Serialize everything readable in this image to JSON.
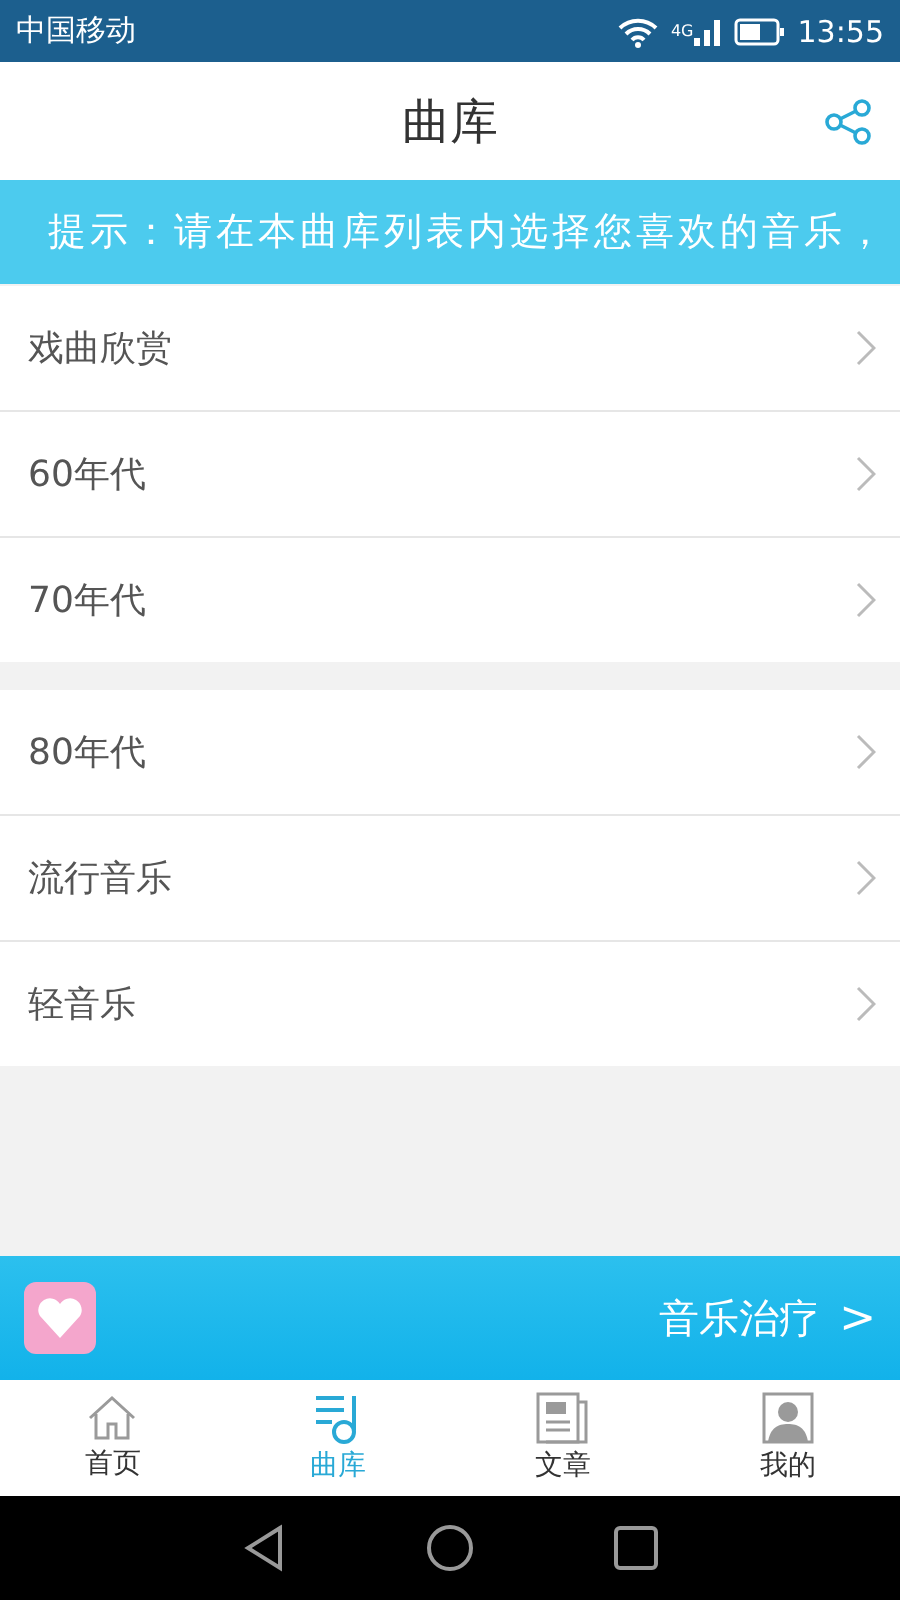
{
  "status_bar": {
    "carrier": "中国移动",
    "network": "4G",
    "time": "13:55"
  },
  "header": {
    "title": "曲库"
  },
  "notice": {
    "text": "提示：请在本曲库列表内选择您喜欢的音乐，"
  },
  "groups": [
    {
      "items": [
        {
          "label": "戏曲欣赏"
        },
        {
          "label": "60年代"
        },
        {
          "label": "70年代"
        }
      ]
    },
    {
      "items": [
        {
          "label": "80年代"
        },
        {
          "label": "流行音乐"
        },
        {
          "label": "轻音乐"
        }
      ]
    }
  ],
  "banner": {
    "label": "音乐治疗",
    "arrow": ">"
  },
  "tabs": [
    {
      "label": "首页",
      "kind": "home",
      "selected": false
    },
    {
      "label": "曲库",
      "kind": "library",
      "selected": true
    },
    {
      "label": "文章",
      "kind": "article",
      "selected": false
    },
    {
      "label": "我的",
      "kind": "profile",
      "selected": false
    }
  ]
}
